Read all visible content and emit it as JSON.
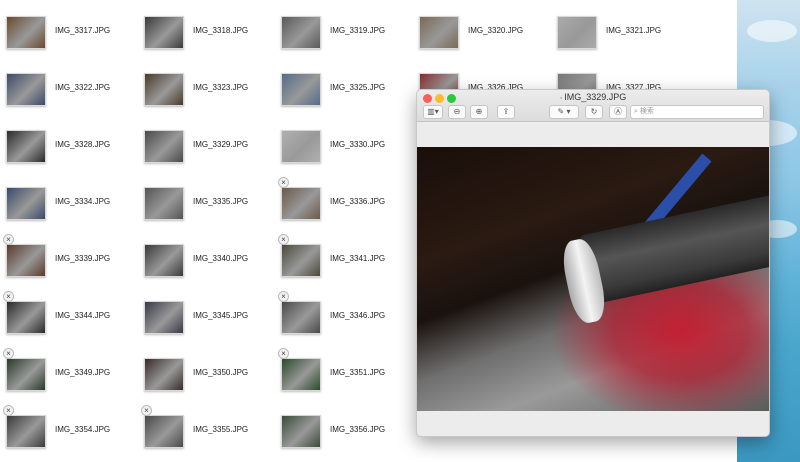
{
  "files": [
    {
      "name": "IMG_3317.JPG",
      "badge": false
    },
    {
      "name": "IMG_3318.JPG",
      "badge": false
    },
    {
      "name": "IMG_3319.JPG",
      "badge": false
    },
    {
      "name": "IMG_3320.JPG",
      "badge": false
    },
    {
      "name": "IMG_3321.JPG",
      "badge": false
    },
    {
      "name": "IMG_3322.JPG",
      "badge": false
    },
    {
      "name": "IMG_3323.JPG",
      "badge": false
    },
    {
      "name": "IMG_3325.JPG",
      "badge": false
    },
    {
      "name": "IMG_3326.JPG",
      "badge": false
    },
    {
      "name": "IMG_3327.JPG",
      "badge": false
    },
    {
      "name": "IMG_3328.JPG",
      "badge": false
    },
    {
      "name": "IMG_3329.JPG",
      "badge": false
    },
    {
      "name": "IMG_3330.JPG",
      "badge": false
    },
    {
      "name": "IMG_3334.JPG",
      "badge": false
    },
    {
      "name": "IMG_3335.JPG",
      "badge": false
    },
    {
      "name": "IMG_3336.JPG",
      "badge": true
    },
    {
      "name": "IMG_3339.JPG",
      "badge": true
    },
    {
      "name": "IMG_3340.JPG",
      "badge": false
    },
    {
      "name": "IMG_3341.JPG",
      "badge": true
    },
    {
      "name": "IMG_3344.JPG",
      "badge": true
    },
    {
      "name": "IMG_3345.JPG",
      "badge": false
    },
    {
      "name": "IMG_3346.JPG",
      "badge": true
    },
    {
      "name": "IMG_3349.JPG",
      "badge": true
    },
    {
      "name": "IMG_3350.JPG",
      "badge": false
    },
    {
      "name": "IMG_3351.JPG",
      "badge": true
    },
    {
      "name": "IMG_3354.JPG",
      "badge": true
    },
    {
      "name": "IMG_3355.JPG",
      "badge": true
    },
    {
      "name": "IMG_3356.JPG",
      "badge": false
    }
  ],
  "preview": {
    "title": "IMG_3329.JPG",
    "search_placeholder": "検索",
    "toolbar": {
      "sidebar_icon": "sidebar-icon",
      "zoom_out_icon": "zoom-out-icon",
      "zoom_in_icon": "zoom-in-icon",
      "share_icon": "share-icon",
      "markup_icon": "pen-icon",
      "rotate_icon": "rotate-icon",
      "annotate_icon": "markup-circle-icon",
      "search_icon": "search-icon"
    }
  },
  "badge_symbol": "×",
  "colors": {
    "close": "#fc5f57",
    "minimize": "#fdbb2e",
    "zoom": "#28c840"
  }
}
